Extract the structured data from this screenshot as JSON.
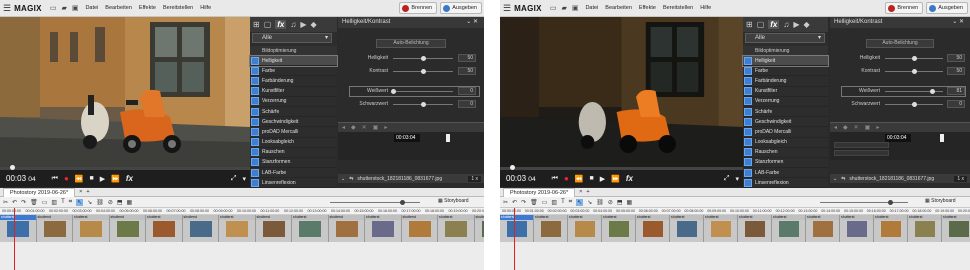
{
  "app": {
    "logo": "MAGIX",
    "menu": [
      "Datei",
      "Bearbeiten",
      "Effekte",
      "Bereitstellen",
      "Hilfe"
    ],
    "burn_label": "Brennen",
    "output_label": "Ausgeben"
  },
  "transport": {
    "timecode": "00:03",
    "timecode_frames": "04"
  },
  "fx_panel": {
    "category": "Alle",
    "section_header": "Bildoptimierung",
    "items": [
      "Helligkeit",
      "Farbe",
      "Farbänderung",
      "Kunstfilter",
      "Verzerrung",
      "Schärfe",
      "Geschwindigkeit",
      "proDAD Mercalli",
      "Looksabgleich",
      "Rauschen",
      "Stanzformen",
      "LAB-Farbe",
      "Linsenreflexion"
    ],
    "selected": "Helligkeit"
  },
  "props_left": {
    "title": "Helligkeit/Kontrast",
    "auto_button": "Auto-Belichtung",
    "rows": [
      {
        "label": "Helligkeit",
        "value": "50",
        "level": 0.5
      },
      {
        "label": "Kontrast",
        "value": "50",
        "level": 0.5
      },
      {
        "label": "Weißwert",
        "value": "0",
        "level": 0.0
      },
      {
        "label": "Schwarzwert",
        "value": "0",
        "level": 0.5
      }
    ],
    "kf_timecode": "00:03:04",
    "file": "shutterstock_182181186_0831677.jpg",
    "speed": "1 x"
  },
  "props_right": {
    "title": "Helligkeit/Kontrast",
    "auto_button": "Auto-Belichtung",
    "rows": [
      {
        "label": "Helligkeit",
        "value": "50",
        "level": 0.5
      },
      {
        "label": "Kontrast",
        "value": "50",
        "level": 0.5
      },
      {
        "label": "Weißwert",
        "value": "81",
        "level": 0.81
      },
      {
        "label": "Schwarzwert",
        "value": "0",
        "level": 0.5
      }
    ],
    "kf_timecode": "00:03:04",
    "file": "shutterstock_182181186_0831677.jpg",
    "speed": "1 x"
  },
  "timeline": {
    "project_tab": "Photostory 2019-06-26*",
    "storyboard_label": "Storyboard",
    "ruler_ticks": [
      "00:00:00:00",
      "00:01:00:00",
      "00:02:00:00",
      "00:03:00:00",
      "00:04:00:00",
      "00:05:00:00",
      "00:06:00:00",
      "00:07:00:00",
      "00:08:00:00",
      "00:09:00:00",
      "00:10:00:00",
      "00:11:00:00",
      "00:12:00:00",
      "00:13:00:00",
      "00:14:00:00",
      "00:15:00:00",
      "00:16:00:00",
      "00:17:00:00",
      "00:18:00:00",
      "00:19:00:00",
      "00:20:00:00"
    ],
    "clip_label": "shutterst"
  },
  "colors": {
    "accent": "#3b7ad0",
    "record": "#e22233",
    "playhead": "#dd2222",
    "selection": "#7fb5ea"
  }
}
